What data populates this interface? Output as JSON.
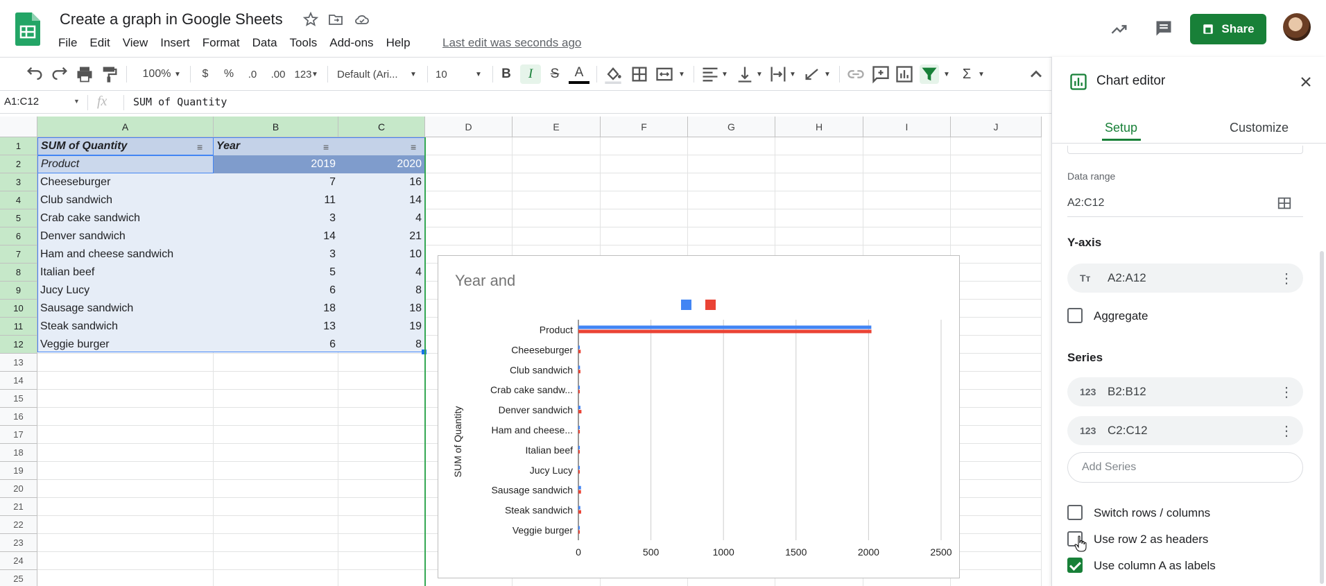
{
  "app": {
    "doc_title": "Create a graph in Google Sheets",
    "menu": [
      "File",
      "Edit",
      "View",
      "Insert",
      "Format",
      "Data",
      "Tools",
      "Add-ons",
      "Help"
    ],
    "last_edit": "Last edit was seconds ago",
    "share_label": "Share"
  },
  "toolbar": {
    "zoom": "100%",
    "currency": "$",
    "percent": "%",
    "dec_decrease": ".0",
    "dec_increase": ".00",
    "more_formats": "123",
    "font": "Default (Ari...",
    "font_size": "10",
    "bold": "B",
    "italic": "I",
    "strike": "S",
    "text_color": "A",
    "functions": "Σ"
  },
  "formula_bar": {
    "name_box": "A1:C12",
    "fx": "fx",
    "content": "SUM of Quantity"
  },
  "grid": {
    "columns": [
      "A",
      "B",
      "C",
      "D",
      "E",
      "F",
      "G",
      "H",
      "I",
      "J"
    ],
    "rows": [
      "1",
      "2",
      "3",
      "4",
      "5",
      "6",
      "7",
      "8",
      "9",
      "10",
      "11",
      "12",
      "13",
      "14",
      "15",
      "16",
      "17",
      "18",
      "19",
      "20",
      "21",
      "22",
      "23",
      "24",
      "25"
    ],
    "header_row": [
      "SUM of Quantity",
      "Year",
      ""
    ],
    "subheader_row": [
      "Product",
      "2019",
      "2020"
    ],
    "data": [
      [
        "Cheeseburger",
        "7",
        "16"
      ],
      [
        "Club sandwich",
        "11",
        "14"
      ],
      [
        "Crab cake sandwich",
        "3",
        "4"
      ],
      [
        "Denver sandwich",
        "14",
        "21"
      ],
      [
        "Ham and cheese sandwich",
        "3",
        "10"
      ],
      [
        "Italian beef",
        "5",
        "4"
      ],
      [
        "Jucy Lucy",
        "6",
        "8"
      ],
      [
        "Sausage sandwich",
        "18",
        "18"
      ],
      [
        "Steak sandwich",
        "13",
        "19"
      ],
      [
        "Veggie burger",
        "6",
        "8"
      ]
    ]
  },
  "chart_data": {
    "type": "bar",
    "orientation": "horizontal",
    "title": "Year and",
    "xlabel": "",
    "ylabel": "SUM of Quantity",
    "categories": [
      "Product",
      "Cheeseburger",
      "Club sandwich",
      "Crab cake sandw...",
      "Denver sandwich",
      "Ham and cheese...",
      "Italian beef",
      "Jucy Lucy",
      "Sausage sandwich",
      "Steak sandwich",
      "Veggie burger"
    ],
    "series": [
      {
        "values": [
          2019,
          7,
          11,
          3,
          14,
          3,
          5,
          6,
          18,
          13,
          6
        ],
        "color": "#4285f4"
      },
      {
        "values": [
          2020,
          16,
          14,
          4,
          21,
          10,
          4,
          8,
          18,
          19,
          8
        ],
        "color": "#ea4335"
      }
    ],
    "xlim": [
      0,
      2500
    ],
    "xticks": [
      "0",
      "500",
      "1000",
      "1500",
      "2000",
      "2500"
    ],
    "grid": true,
    "legend": "top"
  },
  "panel": {
    "title": "Chart editor",
    "tabs": [
      "Setup",
      "Customize"
    ],
    "data_range_label": "Data range",
    "data_range_value": "A2:C12",
    "yaxis_heading": "Y-axis",
    "yaxis_chip": "A2:A12",
    "yaxis_icon": "Tт",
    "aggregate_label": "Aggregate",
    "series_heading": "Series",
    "series_chips": [
      "B2:B12",
      "C2:C12"
    ],
    "series_icon": "123",
    "add_series_placeholder": "Add Series",
    "switch_rows_label": "Switch rows / columns",
    "use_row_label": "Use row 2 as headers",
    "use_column_label": "Use column A as labels",
    "accent_color": "#188038"
  }
}
